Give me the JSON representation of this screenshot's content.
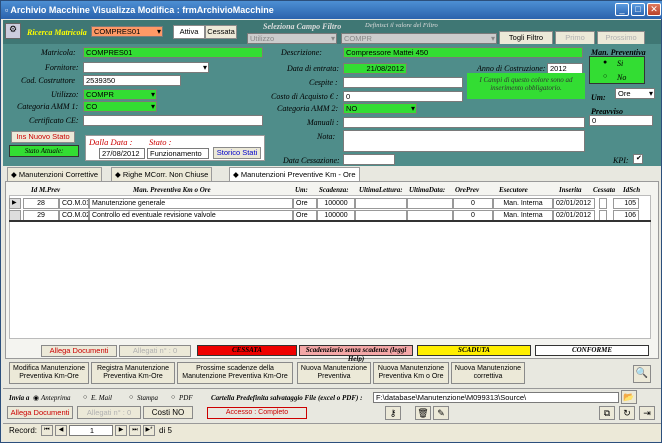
{
  "title": "Archivio Macchine Visualizza Modifica : frmArchivioMacchine",
  "window_buttons": {
    "min": "_",
    "max": "□",
    "close": "✕"
  },
  "top": {
    "ricerca_label": "Ricerca Matricola",
    "ricerca_value": "COMPRES01",
    "attiva": "Attiva",
    "cessata": "Cessata",
    "sel_campo": "Seleziona Campo Filtro",
    "def_valore": "Definisci il valore del Filtro",
    "filtro_campo": "Utilizzo",
    "filtro_valore": "COMPR",
    "togli": "Togli Filtro",
    "primo": "Primo",
    "prossimo": "Prossimo"
  },
  "form": {
    "matricola_l": "Matricola:",
    "matricola": "COMPRES01",
    "fornitore_l": "Fornitore:",
    "codcostr_l": "Cod. Costruttore",
    "codcostr": "2539350",
    "utilizzo_l": "Utilizzo:",
    "utilizzo": "COMPR",
    "catamm1_l": "Categoria AMM 1:",
    "catamm1": "CO",
    "certce_l": "Certificato CE:",
    "descr_l": "Descrizione:",
    "descr": "Compressore Mattei 450",
    "dataentr_l": "Data di entrata:",
    "dataentr": "21/08/2012",
    "anno_l": "Anno di Costruzione:",
    "anno": "2012",
    "cespite_l": "Cespite :",
    "costo_l": "Costo di Acquisto € :",
    "costo": "0",
    "catamm2_l": "Categoria AMM 2:",
    "catamm2": "NO",
    "manuali_l": "Manuali :",
    "nota_l": "Nota:",
    "datacess_l": "Data Cessazione:",
    "kpi_l": "KPI:",
    "note_green": "I Campi di questo colore sono ad inserimento obbligatorio.",
    "manprev_l": "Man. Preventiva",
    "si": "Si",
    "no": "No",
    "um_l": "Um:",
    "um": "Ore",
    "preavviso_l": "Preavviso",
    "preavviso": "0",
    "ins_stato": "Ins Nuovo Stato",
    "stato_att": "Stato Attuale:",
    "dalla_l": "Dalla Data :",
    "dalla": "27/08/2012",
    "stato_l": "Stato :",
    "stato": "Funzionamento",
    "storico": "Storico Stati"
  },
  "tabs": [
    "Manutenzioni Correttive",
    "Righe MCorr. Non Chiuse",
    "Manutenzioni Preventive Km - Ore"
  ],
  "grid": {
    "headers": [
      "Id M.Prev",
      "Man. Preventiva Km o Ore",
      "Um:",
      "Scadenza:",
      "UltimaLettura:",
      "UltimaData:",
      "OrePrev",
      "Esecutore",
      "Inserita",
      "Cessata",
      "IdSch"
    ],
    "rows": [
      [
        "28",
        "CO.M.01",
        "Manutenzione generale",
        "Ore",
        "100000",
        "",
        "",
        "0",
        "Man. Interna",
        "02/01/2012",
        "",
        "105"
      ],
      [
        "29",
        "CO.M.02",
        "Controllo ed eventuale revisione valvole",
        "Ore",
        "100000",
        "",
        "",
        "0",
        "Man. Interna",
        "02/01/2012",
        "",
        "106"
      ]
    ]
  },
  "legend": {
    "allega": "Allega Documenti",
    "allegati": "Allegati n° : 0",
    "cessata": "CESSATA",
    "scad": "Scadenziario senza scadenze (leggi Help)",
    "scaduta": "SCADUTA",
    "conforme": "CONFORME"
  },
  "buttons": [
    "Modifica Manutenzione Preventiva Km-Ore",
    "Registra Manutenzione Preventiva Km-Ore",
    "Prossime scadenze della Manutenzione Preventiva Km-Ore",
    "Nuova Manutenzione Preventiva",
    "Nuova Manutenzione Preventiva Km o Ore",
    "Nuova Manutenzione correttiva"
  ],
  "bottom": {
    "invia": "Invia a",
    "antep": "Anteprima",
    "email": "E. Mail",
    "stampa": "Stampa",
    "pdf": "PDF",
    "cartella_l": "Cartella Predefinita  salvataggio File (excel o PDF) :",
    "cartella": "F:\\database\\Manutenzione\\M099313\\Source\\",
    "allega": "Allega Documenti",
    "allegati": "Allegati n° : 0",
    "costi": "Costi NO",
    "accesso": "Accesso : Completo",
    "record_l": "Record:",
    "record": "1",
    "di": "di 5"
  }
}
